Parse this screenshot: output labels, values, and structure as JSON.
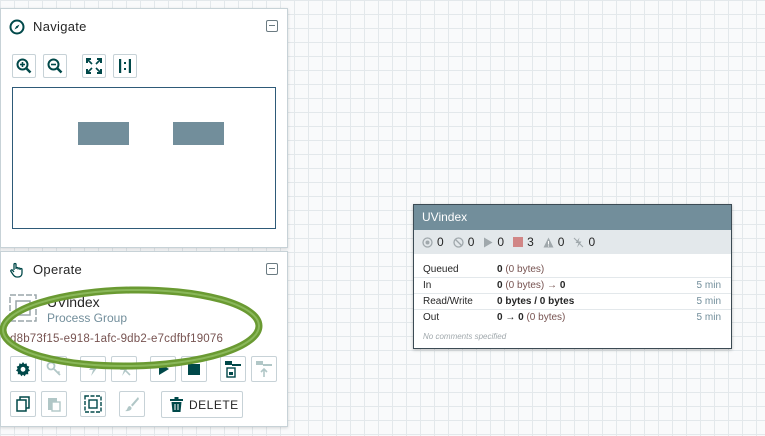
{
  "navigate": {
    "title": "Navigate",
    "icon": "compass-icon",
    "buttons": [
      "zoom-in-icon",
      "zoom-out-icon",
      "fit-icon",
      "actual-size-icon"
    ]
  },
  "operate": {
    "title": "Operate",
    "icon": "hand-pointer-icon",
    "selection": {
      "name": "UVindex",
      "type": "Process Group",
      "id": "d8b73f15-e918-1afc-9db2-e7cdfbf19076"
    },
    "delete_label": "DELETE"
  },
  "process_group": {
    "name": "UVindex",
    "status": {
      "transmitting": "0",
      "not_transmitting": "0",
      "running": "0",
      "stopped": "3",
      "invalid": "0",
      "disabled": "0"
    },
    "stats": [
      {
        "label": "Queued",
        "value_bold": "0",
        "value_rest": " (0 bytes)",
        "time": ""
      },
      {
        "label": "In",
        "value_bold": "0",
        "value_rest": " (0 bytes) → ",
        "value_bold2": "0",
        "time": "5 min"
      },
      {
        "label": "Read/Write",
        "value_bold": "0 bytes / 0 bytes",
        "value_rest": "",
        "time": "5 min"
      },
      {
        "label": "Out",
        "value_bold": "0 → 0",
        "value_rest": " (0 bytes)",
        "time": "5 min"
      }
    ],
    "comments": "No comments specified"
  },
  "colors": {
    "header_bg": "#728e9b",
    "accent": "#004849",
    "stopped": "#d18686",
    "highlight": "#73a13a"
  }
}
